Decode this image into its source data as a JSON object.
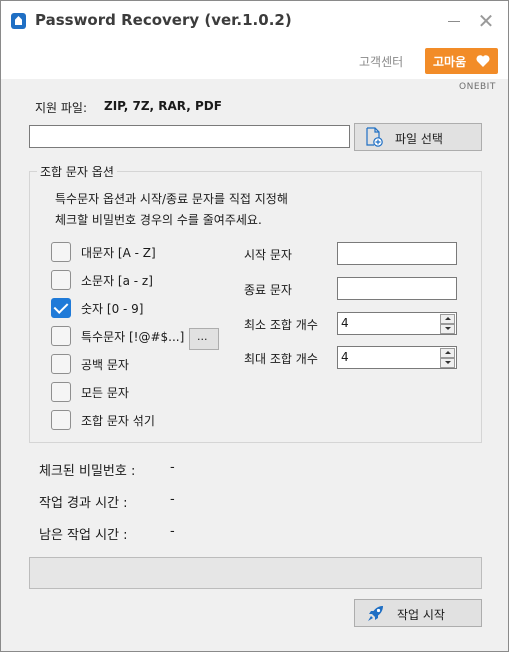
{
  "window": {
    "title": "Password Recovery (ver.1.0.2)",
    "minimize_icon": "minimize-icon",
    "close_glyph": "✕"
  },
  "header": {
    "support_link": "고객센터",
    "thanks_button": "고마움",
    "heart_icon": "heart-icon",
    "brand": "ONEBIT",
    "accent_color": "#f28c28"
  },
  "supported": {
    "label": "지원 파일:",
    "formats": "ZIP, 7Z, RAR, PDF"
  },
  "file": {
    "path_value": "",
    "select_button": "파일 선택",
    "icon": "file-add-icon"
  },
  "options": {
    "group_title": "조합 문자 옵션",
    "description_line1": "특수문자 옵션과 시작/종료 문자를 직접 지정해",
    "description_line2": "체크할 비밀번호 경우의 수를 줄여주세요.",
    "checkboxes": [
      {
        "label": "대문자 [A - Z]",
        "checked": false
      },
      {
        "label": "소문자 [a - z]",
        "checked": false
      },
      {
        "label": "숫자 [0 - 9]",
        "checked": true
      },
      {
        "label": "특수문자 [!@#$...]",
        "checked": false
      },
      {
        "label": "공백 문자",
        "checked": false
      },
      {
        "label": "모든 문자",
        "checked": false
      },
      {
        "label": "조합 문자 섞기",
        "checked": false
      }
    ],
    "special_chars_button": "...",
    "start_char_label": "시작 문자",
    "start_char_value": "",
    "end_char_label": "종료 문자",
    "end_char_value": "",
    "min_count_label": "최소 조합 개수",
    "min_count_value": "4",
    "max_count_label": "최대 조합 개수",
    "max_count_value": "4",
    "checkbox_color": "#1f7ad8"
  },
  "status": {
    "checked_label": "체크된 비밀번호 :",
    "checked_value": "-",
    "elapsed_label": "작업 경과 시간 :",
    "elapsed_value": "-",
    "remaining_label": "남은 작업 시간 :",
    "remaining_value": "-"
  },
  "progress": {
    "percent": 0
  },
  "actions": {
    "start_button": "작업 시작",
    "icon": "rocket-icon"
  }
}
